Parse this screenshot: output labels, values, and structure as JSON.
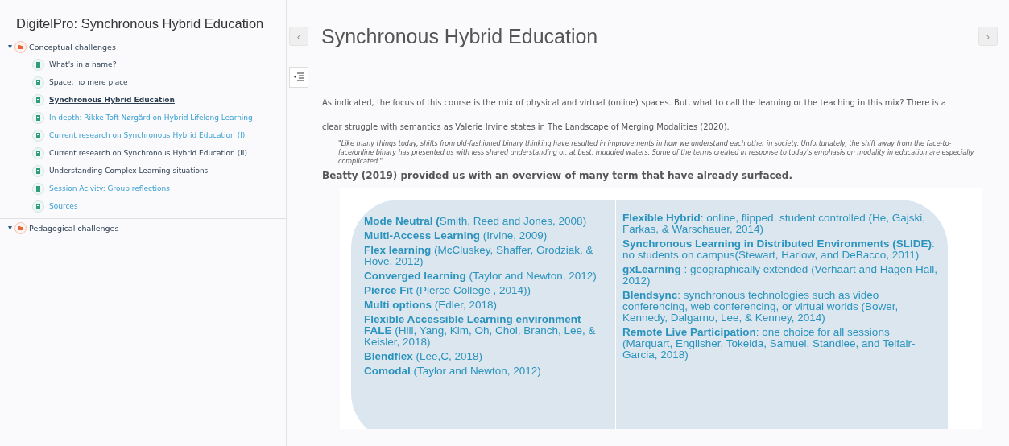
{
  "sidebar": {
    "title": "DigitelPro: Synchronous Hybrid Education",
    "sections": [
      {
        "label": "Conceptual challenges",
        "expanded": true,
        "children": [
          {
            "label": "What's in a name?",
            "visited": false,
            "selected": false
          },
          {
            "label": "Space, no mere place",
            "visited": false,
            "selected": false
          },
          {
            "label": "Synchronous Hybrid Education",
            "visited": false,
            "selected": true
          },
          {
            "label": "In depth: Rikke Toft Nørgård on Hybrid Lifelong Learning",
            "visited": true,
            "selected": false
          },
          {
            "label": "Current research on Synchronous Hybrid Education (I)",
            "visited": true,
            "selected": false
          },
          {
            "label": "Current research on Synchronous Hybrid Education (II)",
            "visited": false,
            "selected": false
          },
          {
            "label": "Understanding Complex Learning situations",
            "visited": false,
            "selected": false
          },
          {
            "label": "Session Acivity: Group reflections",
            "visited": true,
            "selected": false
          },
          {
            "label": "Sources",
            "visited": true,
            "selected": false
          }
        ]
      },
      {
        "label": "Pedagogical challenges",
        "expanded": true
      }
    ]
  },
  "page": {
    "prev": "‹",
    "next": "›",
    "title": "Synchronous Hybrid Education",
    "intro": "As indicated, the focus of this course is the mix of physical and virtual (online) spaces. But, what to call the learning or the teaching in this mix? There is a clear struggle with semantics as Valerie Irvine states in The Landscape of Merging Modalities (2020).",
    "quote": "\"Like many things today, shifts from old-fashioned binary thinking have resulted in improvements in how we understand each other in society. Unfortunately, the shift away from the face-to-face/online binary has presented us with less shared understanding or, at best, muddied waters. Some of the terms created in response to today's emphasis on modality in education are especially complicated.\"",
    "lead": "Beatty (2019) provided us with an overview of many term that have already surfaced.",
    "figure": {
      "columns": [
        [
          "**Mode Neutral (**Smith, Reed and Jones, 2008)",
          "**Multi-Access Learning** (Irvine, 2009)",
          "**Flex learning** (McCluskey, Shaffer, Grodziak, & Hove, 2012)",
          "**Converged learning** (Taylor and Newton, 2012)",
          "**Pierce Fit** (Pierce College , 2014))",
          "**Multi options** (Edler, 2018)",
          "**Flexible Accessible Learning environment FALE** (Hill, Yang, Kim, Oh, Choi, Branch, Lee, & Keisler, 2018)",
          "**Blendflex** (Lee,C, 2018)",
          "**Comodal** (Taylor and Newton, 2012)"
        ],
        [
          "**Flexible Hybrid**: online, flipped, student controlled (He, Gajski, Farkas, & Warschauer, 2014)",
          "**Synchronous Learning in Distributed Environments (SLIDE)**: no students on campus(Stewart, Harlow, and DeBacco, 2011)",
          "**gxLearning** : geographically extended (Verhaart and Hagen-Hall, 2012)",
          "**Blendsync**:  synchronous technologies such as video conferencing, web conferencing, or virtual worlds (Bower, Kennedy, Dalgarno, Lee, & Kenney, 2014)",
          "**Remote Live Participation**: one choice for all sessions (Marquart, Englisher, Tokeida, Samuel, Standlee, and Telfair-Garcia, 2018)"
        ]
      ]
    }
  }
}
